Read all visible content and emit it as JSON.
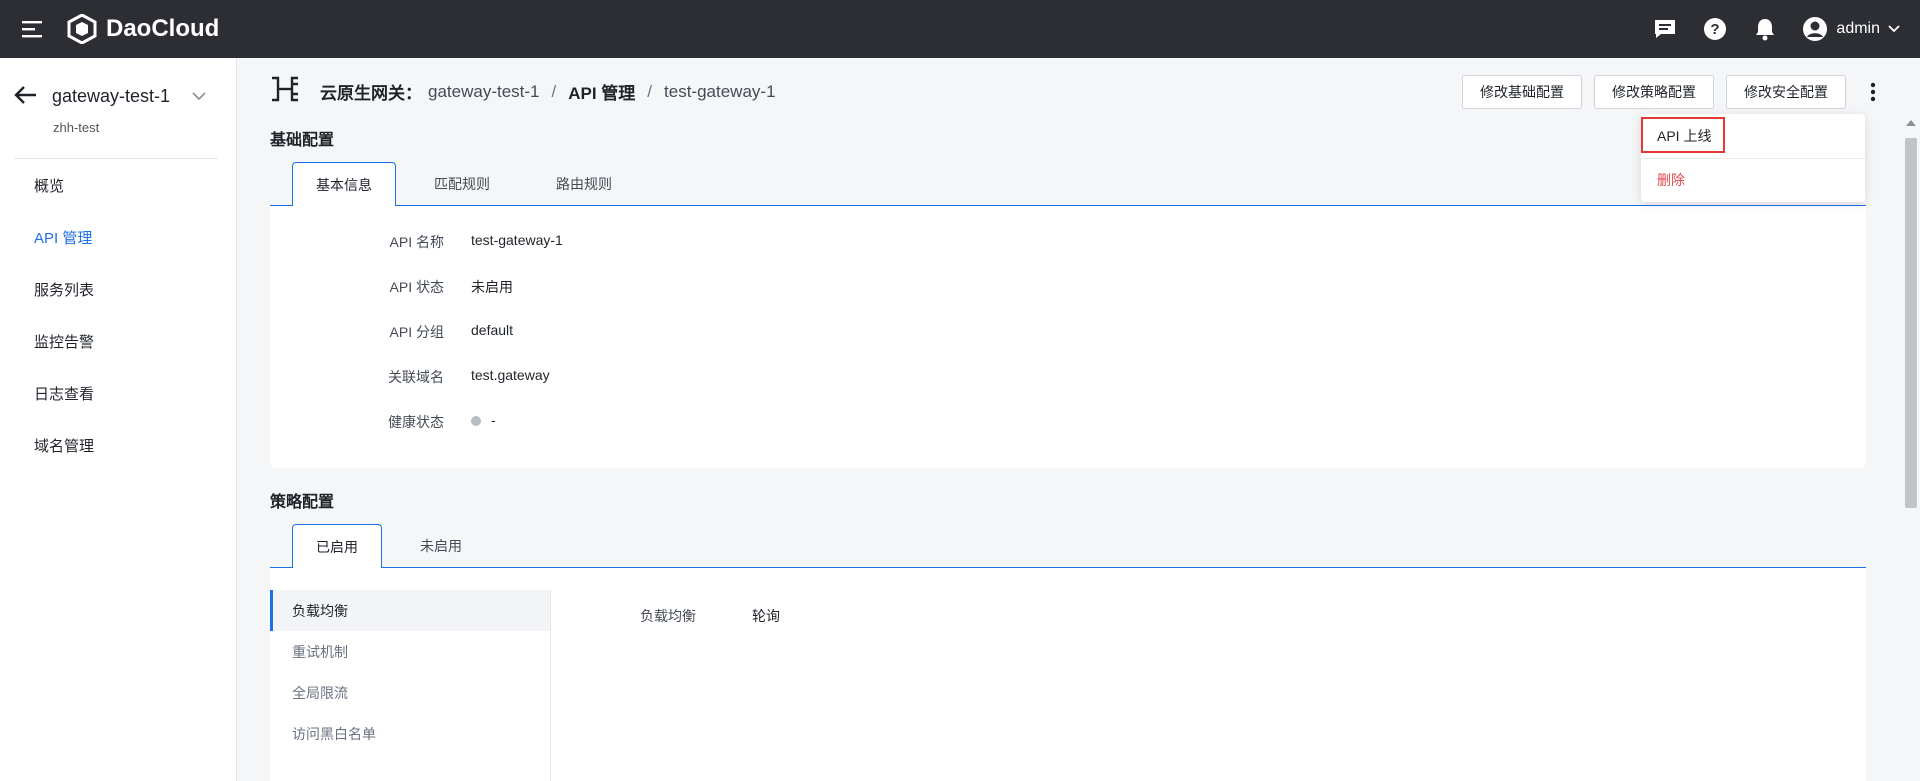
{
  "app": {
    "brand": "DaoCloud",
    "user": "admin"
  },
  "sidebar": {
    "gateway_name": "gateway-test-1",
    "namespace": "zhh-test",
    "items": [
      {
        "label": "概览",
        "active": false
      },
      {
        "label": "API 管理",
        "active": true
      },
      {
        "label": "服务列表",
        "active": false
      },
      {
        "label": "监控告警",
        "active": false
      },
      {
        "label": "日志查看",
        "active": false
      },
      {
        "label": "域名管理",
        "active": false
      }
    ]
  },
  "breadcrumb": {
    "root": "云原生网关：",
    "gateway": "gateway-test-1",
    "section": "API 管理",
    "current": "test-gateway-1",
    "separator": "/"
  },
  "actions": {
    "edit_basic": "修改基础配置",
    "edit_policy": "修改策略配置",
    "edit_security": "修改安全配置"
  },
  "dropdown": {
    "online": "API 上线",
    "delete": "删除"
  },
  "basic_config": {
    "title": "基础配置",
    "tabs": [
      "基本信息",
      "匹配规则",
      "路由规则"
    ],
    "fields": [
      {
        "key": "API 名称",
        "value": "test-gateway-1"
      },
      {
        "key": "API 状态",
        "value": "未启用"
      },
      {
        "key": "API 分组",
        "value": "default"
      },
      {
        "key": "关联域名",
        "value": "test.gateway"
      },
      {
        "key": "健康状态",
        "value": "-"
      }
    ]
  },
  "policy_config": {
    "title": "策略配置",
    "tabs": [
      "已启用",
      "未启用"
    ],
    "items": [
      "负载均衡",
      "重试机制",
      "全局限流",
      "访问黑白名单"
    ],
    "detail_key": "负载均衡",
    "detail_value": "轮询"
  },
  "colors": {
    "accent": "#1d6fe6",
    "danger": "#e5484d",
    "topbar": "#2c2e33"
  }
}
